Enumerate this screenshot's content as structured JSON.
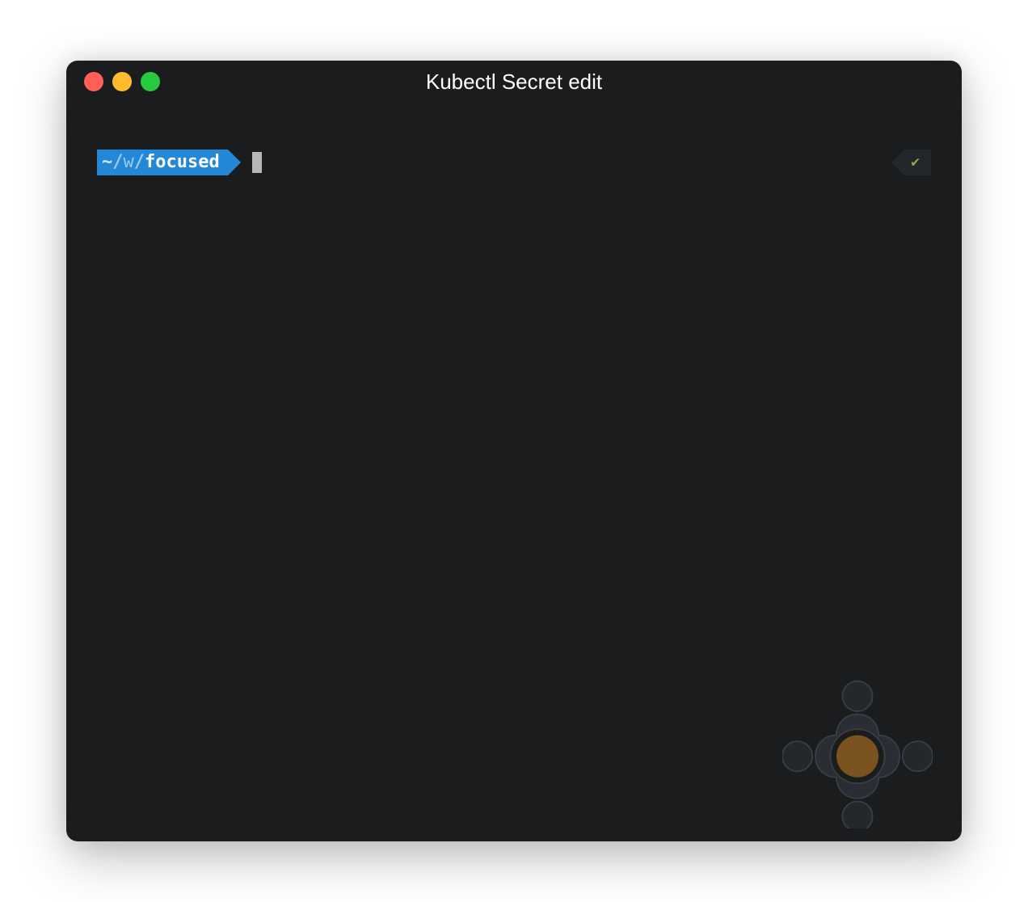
{
  "window": {
    "title": "Kubectl Secret edit"
  },
  "prompt": {
    "home": "~",
    "sep1": "/",
    "w": "w",
    "sep2": "/",
    "dir": "focused"
  },
  "status": {
    "check_glyph": "✔"
  }
}
